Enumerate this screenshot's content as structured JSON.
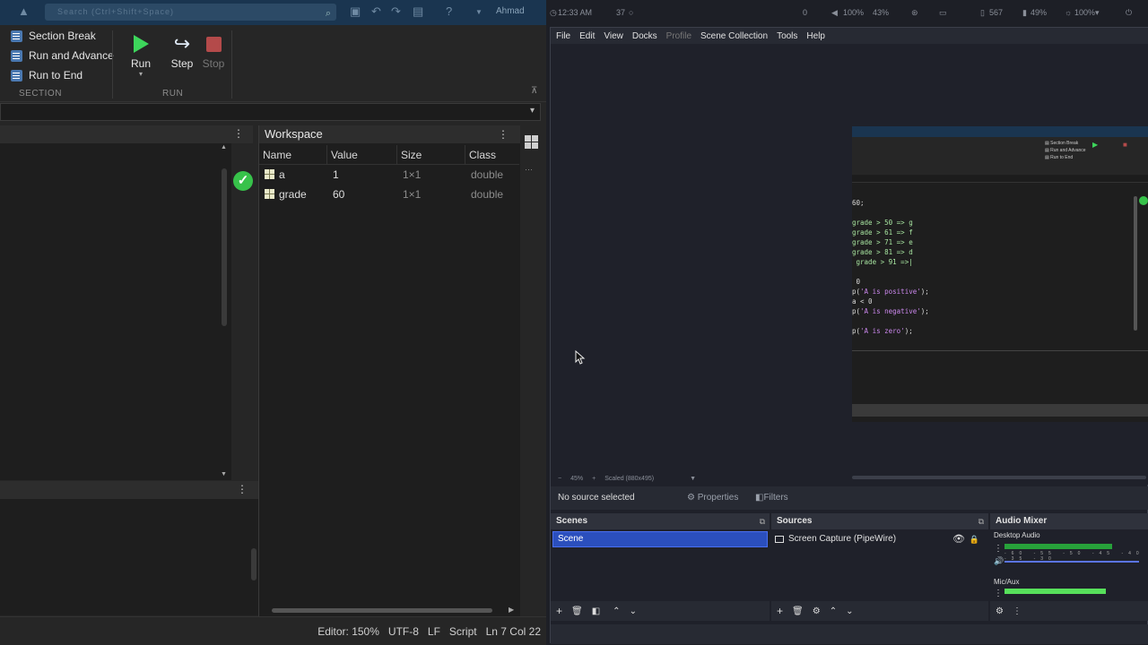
{
  "matlab": {
    "search_placeholder": "Search (Ctrl+Shift+Space)",
    "user": "Ahmad",
    "ribbon": {
      "section_items": [
        "Section Break",
        "Run and Advance",
        "Run to End"
      ],
      "section_label": "SECTION",
      "run_label": "RUN",
      "run_buttons": [
        "Run",
        "Step",
        "Stop"
      ]
    },
    "workspace": {
      "title": "Workspace",
      "columns": [
        "Name",
        "Value",
        "Size",
        "Class"
      ],
      "rows": [
        {
          "name": "a",
          "value": "1",
          "size": "1×1",
          "class": "double"
        },
        {
          "name": "grade",
          "value": "60",
          "size": "1×1",
          "class": "double"
        }
      ]
    },
    "status": {
      "zoom": "Editor: 150%",
      "encoding": "UTF-8",
      "eol": "LF",
      "type": "Script",
      "position": "Ln 7 Col 22"
    }
  },
  "system_bar": {
    "time": "12:33 AM",
    "count": "37",
    "vals": [
      "0",
      "100%",
      "43%",
      "567",
      "49%",
      "100%"
    ]
  },
  "obs": {
    "menu": [
      "File",
      "Edit",
      "View",
      "Docks",
      "Profile",
      "Scene Collection",
      "Tools",
      "Help"
    ],
    "zoom": "45%",
    "scaled": "Scaled (880x495)",
    "no_source": "No source selected",
    "properties": "Properties",
    "filters": "Filters",
    "scenes_title": "Scenes",
    "scene_item": "Scene",
    "sources_title": "Sources",
    "source_item": "Screen Capture (PipeWire)",
    "mixer_title": "Audio Mixer",
    "desktop_audio": "Desktop Audio",
    "mic_aux": "Mic/Aux",
    "ticks": "-60 -55 -50 -45 -40 -35 -30",
    "desktop_level": 0.8,
    "mic_level": 0.75
  },
  "captured_code": [
    "60;",
    "",
    "grade > 50 => g",
    "grade > 61 => f",
    "grade > 71 => e",
    "grade > 81 => d",
    " grade > 91 =>|",
    "",
    " 0",
    "p('A is positive');",
    "a < 0",
    "p('A is negative');",
    "",
    "p('A is zero');"
  ]
}
